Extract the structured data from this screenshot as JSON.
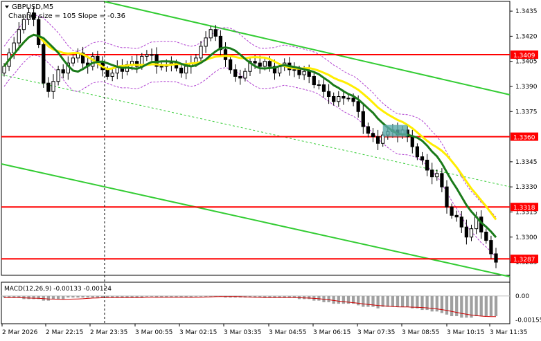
{
  "header": {
    "symbol": "GBPUSD,M5",
    "indicator": "Channel size = 105 Slope = -0.36",
    "macd_label": "MACD(12,26,9) -0.00133 -0.00124"
  },
  "colors": {
    "candle": "#000000",
    "level": "#ff0000",
    "channel": "#33cc33",
    "ma_fast": "#1a7a1a",
    "ma_slow": "#ffee00",
    "envelope": "#b040d0",
    "macd_hist": "#a0a0a0",
    "macd_signal": "#cc0000",
    "entry_box": "#5aa9a9"
  },
  "chart_data": {
    "type": "candlestick",
    "y_axis": {
      "min": 1.3278,
      "max": 1.344,
      "ticks": [
        "1.3435",
        "1.3420",
        "1.3405",
        "1.3390",
        "1.3375",
        "1.3345",
        "1.3330",
        "1.3315",
        "1.3300",
        "1.3285"
      ]
    },
    "x_axis": {
      "labels": [
        "2 Mar 2026",
        "2 Mar 22:15",
        "2 Mar 23:35",
        "3 Mar 00:55",
        "3 Mar 02:15",
        "3 Mar 03:35",
        "3 Mar 04:55",
        "3 Mar 06:15",
        "3 Mar 07:35",
        "3 Mar 08:55",
        "3 Mar 10:15",
        "3 Mar 11:35"
      ]
    },
    "levels": [
      {
        "value": 1.3409,
        "label": "1.3409"
      },
      {
        "value": 1.336,
        "label": "1.3360"
      },
      {
        "value": 1.3318,
        "label": "1.3318"
      },
      {
        "value": 1.3287,
        "label": "1.3287"
      }
    ],
    "close": [
      1.3402,
      1.341,
      1.3416,
      1.3424,
      1.343,
      1.3434,
      1.343,
      1.3415,
      1.3392,
      1.3387,
      1.3393,
      1.34,
      1.3398,
      1.3404,
      1.3407,
      1.341,
      1.3404,
      1.3402,
      1.3408,
      1.3404,
      1.34,
      1.3396,
      1.3398,
      1.3402,
      1.3399,
      1.3403,
      1.3405,
      1.3402,
      1.3408,
      1.3409,
      1.3409,
      1.3402,
      1.3402,
      1.3403,
      1.3404,
      1.3401,
      1.3398,
      1.3402,
      1.3404,
      1.3407,
      1.3414,
      1.3419,
      1.3424,
      1.342,
      1.3412,
      1.3406,
      1.34,
      1.3396,
      1.3395,
      1.3399,
      1.3405,
      1.3404,
      1.3402,
      1.3405,
      1.3402,
      1.3398,
      1.3402,
      1.3404,
      1.34,
      1.34,
      1.3397,
      1.3399,
      1.3396,
      1.3391,
      1.3391,
      1.3387,
      1.3384,
      1.3381,
      1.3384,
      1.3383,
      1.3383,
      1.3381,
      1.3375,
      1.3366,
      1.3362,
      1.336,
      1.3356,
      1.3361,
      1.3363,
      1.3364,
      1.3361,
      1.3364,
      1.336,
      1.3354,
      1.3348,
      1.3346,
      1.334,
      1.3336,
      1.3338,
      1.333,
      1.3318,
      1.3313,
      1.3312,
      1.3306,
      1.33,
      1.3305,
      1.3312,
      1.3303,
      1.3298,
      1.329,
      1.3285
    ],
    "macd_hist": [
      -0.0001,
      -0.0001,
      -0.0001,
      -0.0001,
      -0.0002,
      -0.0002,
      -0.0002,
      -0.0002,
      -0.0003,
      -0.0003,
      -0.0002,
      -0.0002,
      -0.0002,
      -0.0001,
      -0.0001,
      -0.0001,
      -0.0001,
      -0.0001,
      -0.0001,
      -0.0001,
      -0.0001,
      -0.0001,
      -0.0001,
      -0.0001,
      -0.0001,
      -0.0001,
      -0.0001,
      -0.0001,
      -0.0001,
      0,
      0,
      -0.0001,
      -0.0001,
      -0.0001,
      -0.0001,
      -0.0001,
      -0.0001,
      -0.0001,
      -0.0001,
      0,
      0,
      0,
      0,
      0,
      0,
      -0.0001,
      -0.0001,
      -0.0001,
      -0.0001,
      -0.0001,
      -0.0001,
      -0.0001,
      -0.0001,
      -0.0001,
      -0.0001,
      -0.0001,
      -0.0001,
      -0.0001,
      -0.0001,
      -0.0001,
      -0.0002,
      -0.0002,
      -0.0002,
      -0.0003,
      -0.0003,
      -0.0004,
      -0.0004,
      -0.0005,
      -0.0005,
      -0.0005,
      -0.0005,
      -0.0005,
      -0.0006,
      -0.0007,
      -0.0007,
      -0.0007,
      -0.0008,
      -0.0007,
      -0.0007,
      -0.0007,
      -0.0007,
      -0.0007,
      -0.0007,
      -0.0008,
      -0.0008,
      -0.0009,
      -0.0009,
      -0.001,
      -0.001,
      -0.0011,
      -0.0012,
      -0.0013,
      -0.0013,
      -0.0014,
      -0.0014,
      -0.0014,
      -0.0013,
      -0.0013,
      -0.0013,
      -0.0013,
      -0.0013
    ],
    "macd_axis": {
      "min": -0.0017,
      "max": 0.0008,
      "ticks": [
        "0.00",
        "-0.00155"
      ]
    }
  }
}
